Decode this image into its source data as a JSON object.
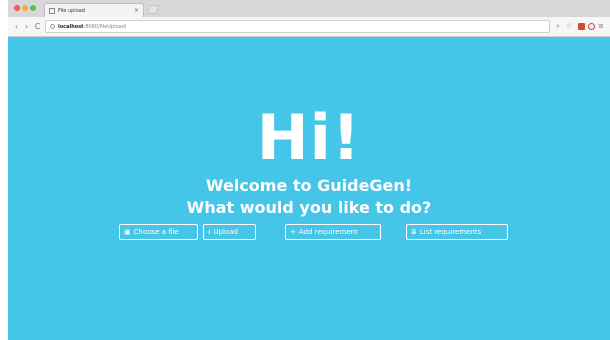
{
  "browser": {
    "tab_title": "File upload",
    "tab_close": "×",
    "new_tab": "",
    "url_host": "localhost",
    "url_path": ":8080/fileUpload/",
    "back_icon": "‹",
    "forward_icon": "›",
    "reload_icon": "C"
  },
  "colors": {
    "page_background": "#45c5e7",
    "text": "#ffffff"
  },
  "hero": {
    "greeting": "Hi!",
    "welcome": "Welcome to GuideGen!",
    "question": "What would you like to do?"
  },
  "actions": {
    "choose_file": {
      "icon": "document-icon",
      "glyph": "▣",
      "label": "Choose a file"
    },
    "upload": {
      "icon": "upload-icon",
      "glyph": "⭳",
      "label": "Upload"
    },
    "add_requirement": {
      "icon": "plus-icon",
      "glyph": "+",
      "label": "Add requirement"
    },
    "list_requirements": {
      "icon": "list-icon",
      "glyph": "≣",
      "label": "List requirements"
    }
  }
}
